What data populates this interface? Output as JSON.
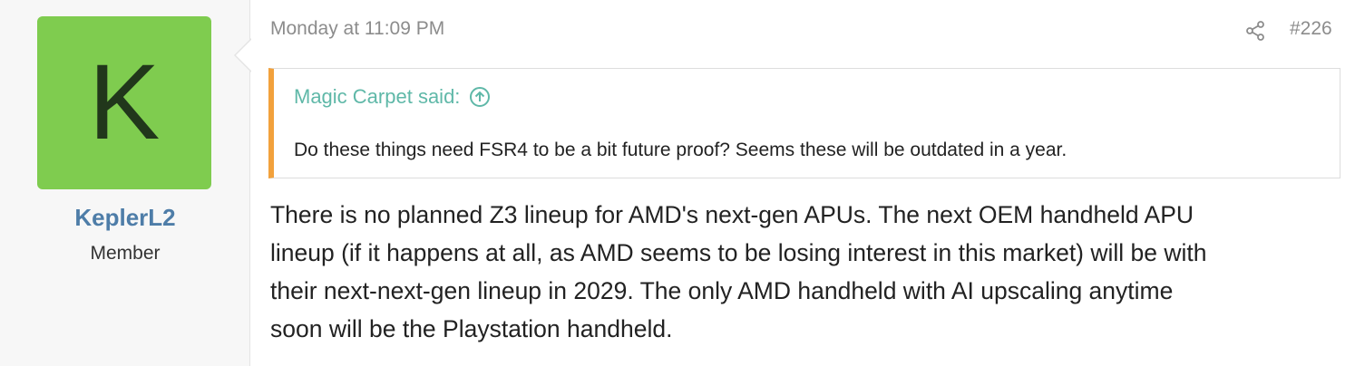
{
  "user": {
    "avatar_letter": "K",
    "avatar_color": "#7fcc4f",
    "name": "KeplerL2",
    "title": "Member"
  },
  "post": {
    "date": "Monday at 11:09 PM",
    "number": "#226",
    "share_icon": "share-icon"
  },
  "quote": {
    "author_label": "Magic Carpet said:",
    "jump_icon": "arrow-up-circle-icon",
    "text": "Do these things need FSR4 to be a bit future proof? Seems these will be outdated in a year.",
    "accent_color": "#f2a13c"
  },
  "message": {
    "lines": [
      "There is no planned Z3 lineup for AMD's next-gen APUs. The next OEM handheld APU",
      "lineup (if it happens at all, as AMD seems to be losing interest in this market) will be with",
      "their next-next-gen lineup in 2029. The only AMD handheld with AI upscaling anytime",
      "soon will be the Playstation handheld."
    ]
  }
}
